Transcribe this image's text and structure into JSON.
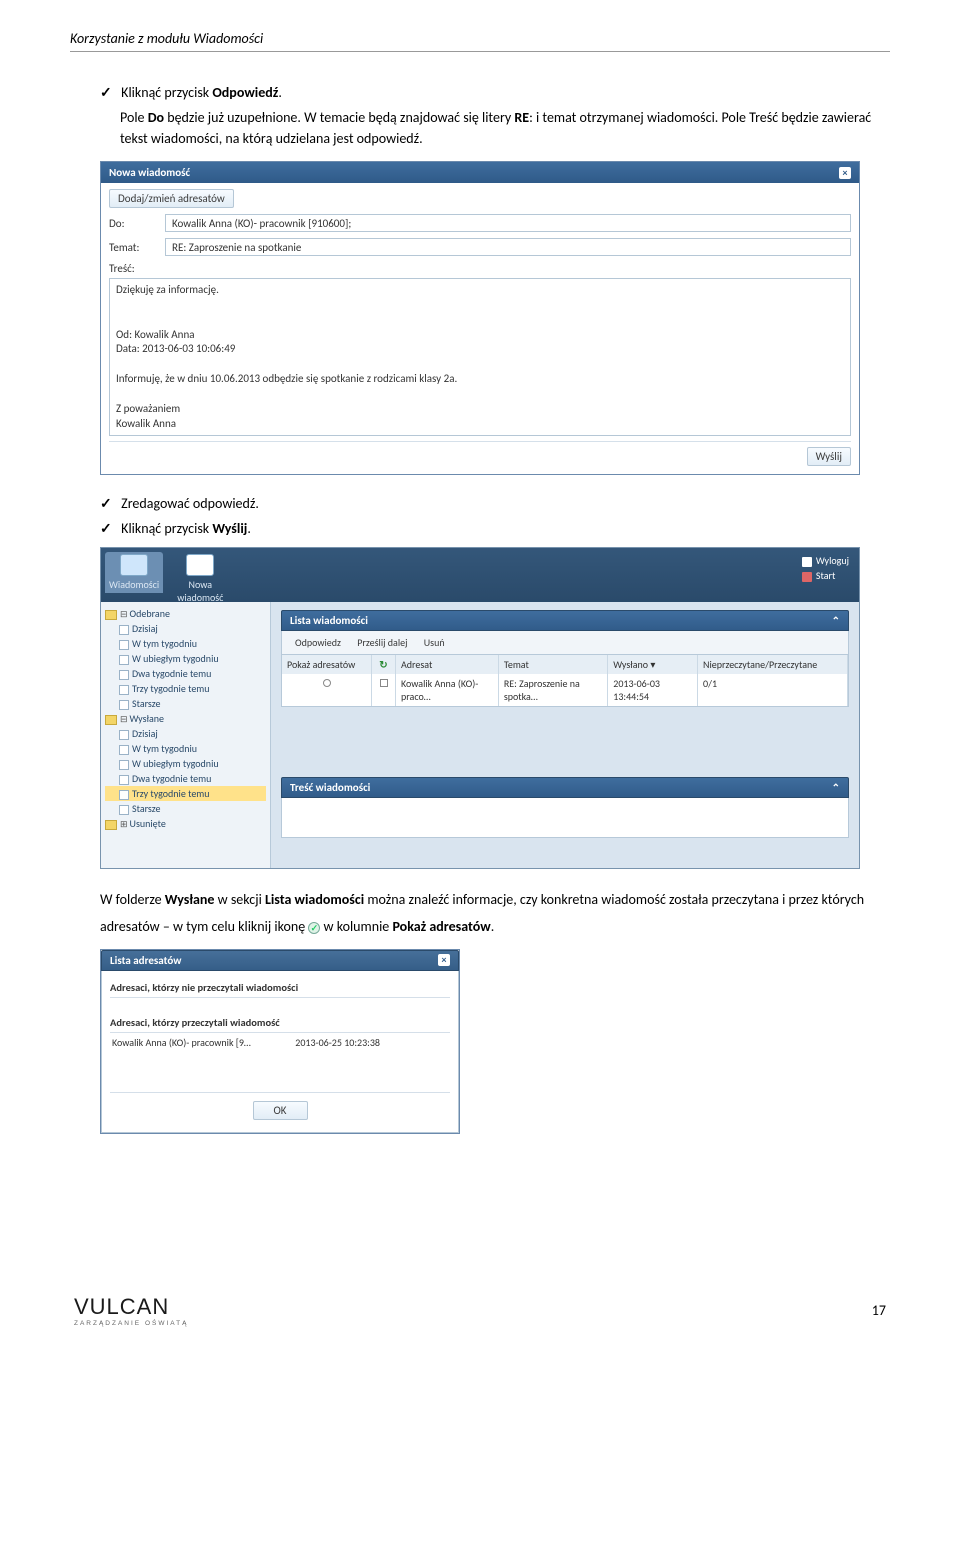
{
  "header": {
    "title": "Korzystanie z modułu Wiadomości"
  },
  "intro": {
    "line1a": "Kliknąć przycisk ",
    "line1b": "Odpowiedź",
    "line1c": ".",
    "p2a": "Pole ",
    "p2b": "Do",
    "p2c": " będzie już uzupełnione. W temacie będą znajdować się litery ",
    "p2d": "RE",
    "p2e": ": i temat otrzymanej wiadomości. Pole Treść będzie zawierać tekst wiadomości, na którą udzielana jest odpowiedź."
  },
  "shot1": {
    "title": "Nowa wiadomość",
    "btn_add": "Dodaj/zmień adresatów",
    "lbl_do": "Do:",
    "val_do": "Kowalik Anna (KO)- pracownik [910600];",
    "lbl_temat": "Temat:",
    "val_temat": "RE: Zaproszenie na spotkanie",
    "lbl_tresc": "Treść:",
    "body": "Dziękuję za informację.\n\n\nOd: Kowalik Anna\nData: 2013-06-03 10:06:49\n\nInformuję, że w dniu 10.06.2013 odbędzie się spotkanie z rodzicami klasy 2a.\n\nZ poważaniem\nKowalik Anna",
    "btn_send": "Wyślij"
  },
  "mid": {
    "b1": "Zredagować odpowiedź.",
    "b2a": "Kliknąć przycisk ",
    "b2b": "Wyślij",
    "b2c": "."
  },
  "shot2": {
    "tile1": "Wiadomości",
    "tile2": "Nowa\nwiadomość",
    "link_logout": "Wyloguj",
    "link_start": "Start",
    "tree": {
      "f1": "Odebrane",
      "f2": "Wysłane",
      "f3": "Usunięte",
      "items": [
        "Dzisiaj",
        "W tym tygodniu",
        "W ubiegłym tygodniu",
        "Dwa tygodnie temu",
        "Trzy tygodnie temu",
        "Starsze"
      ],
      "selected": "Trzy tygodnie temu"
    },
    "list_title": "Lista wiadomości",
    "tb": {
      "a": "Odpowiedz",
      "b": "Prześlij dalej",
      "c": "Usuń"
    },
    "cols": {
      "show": "Pokaż adresatów",
      "adr": "Adresat",
      "tem": "Temat",
      "wys": "Wysłano ▾",
      "prz": "Nieprzeczytane/Przeczytane"
    },
    "row": {
      "adr": "Kowalik Anna (KO)- praco…",
      "tem": "RE: Zaproszenie na spotka…",
      "wys": "2013-06-03 13:44:54",
      "prz": "0/1"
    },
    "content_title": "Treść wiadomości"
  },
  "after": {
    "a": "W folderze ",
    "b": "Wysłane",
    "c": " w sekcji ",
    "d": "Lista wiadomości",
    "e": " można znaleźć informacje, czy konkretna wiadomość została przeczytana i przez których adresatów – w tym celu kliknij ikonę ",
    "f": " w kolumnie ",
    "g": "Pokaż adresatów",
    "h": "."
  },
  "shot3": {
    "title": "Lista adresatów",
    "h1": "Adresaci, którzy nie przeczytali wiadomości",
    "h2": "Adresaci, którzy przeczytali wiadomość",
    "row_name": "Kowalik Anna (KO)- pracownik [9…",
    "row_date": "2013-06-25 10:23:38",
    "ok": "OK"
  },
  "footer": {
    "logo_main": "VULCAN",
    "logo_sub": "ZARZĄDZANIE OŚWIATĄ",
    "page": "17"
  }
}
